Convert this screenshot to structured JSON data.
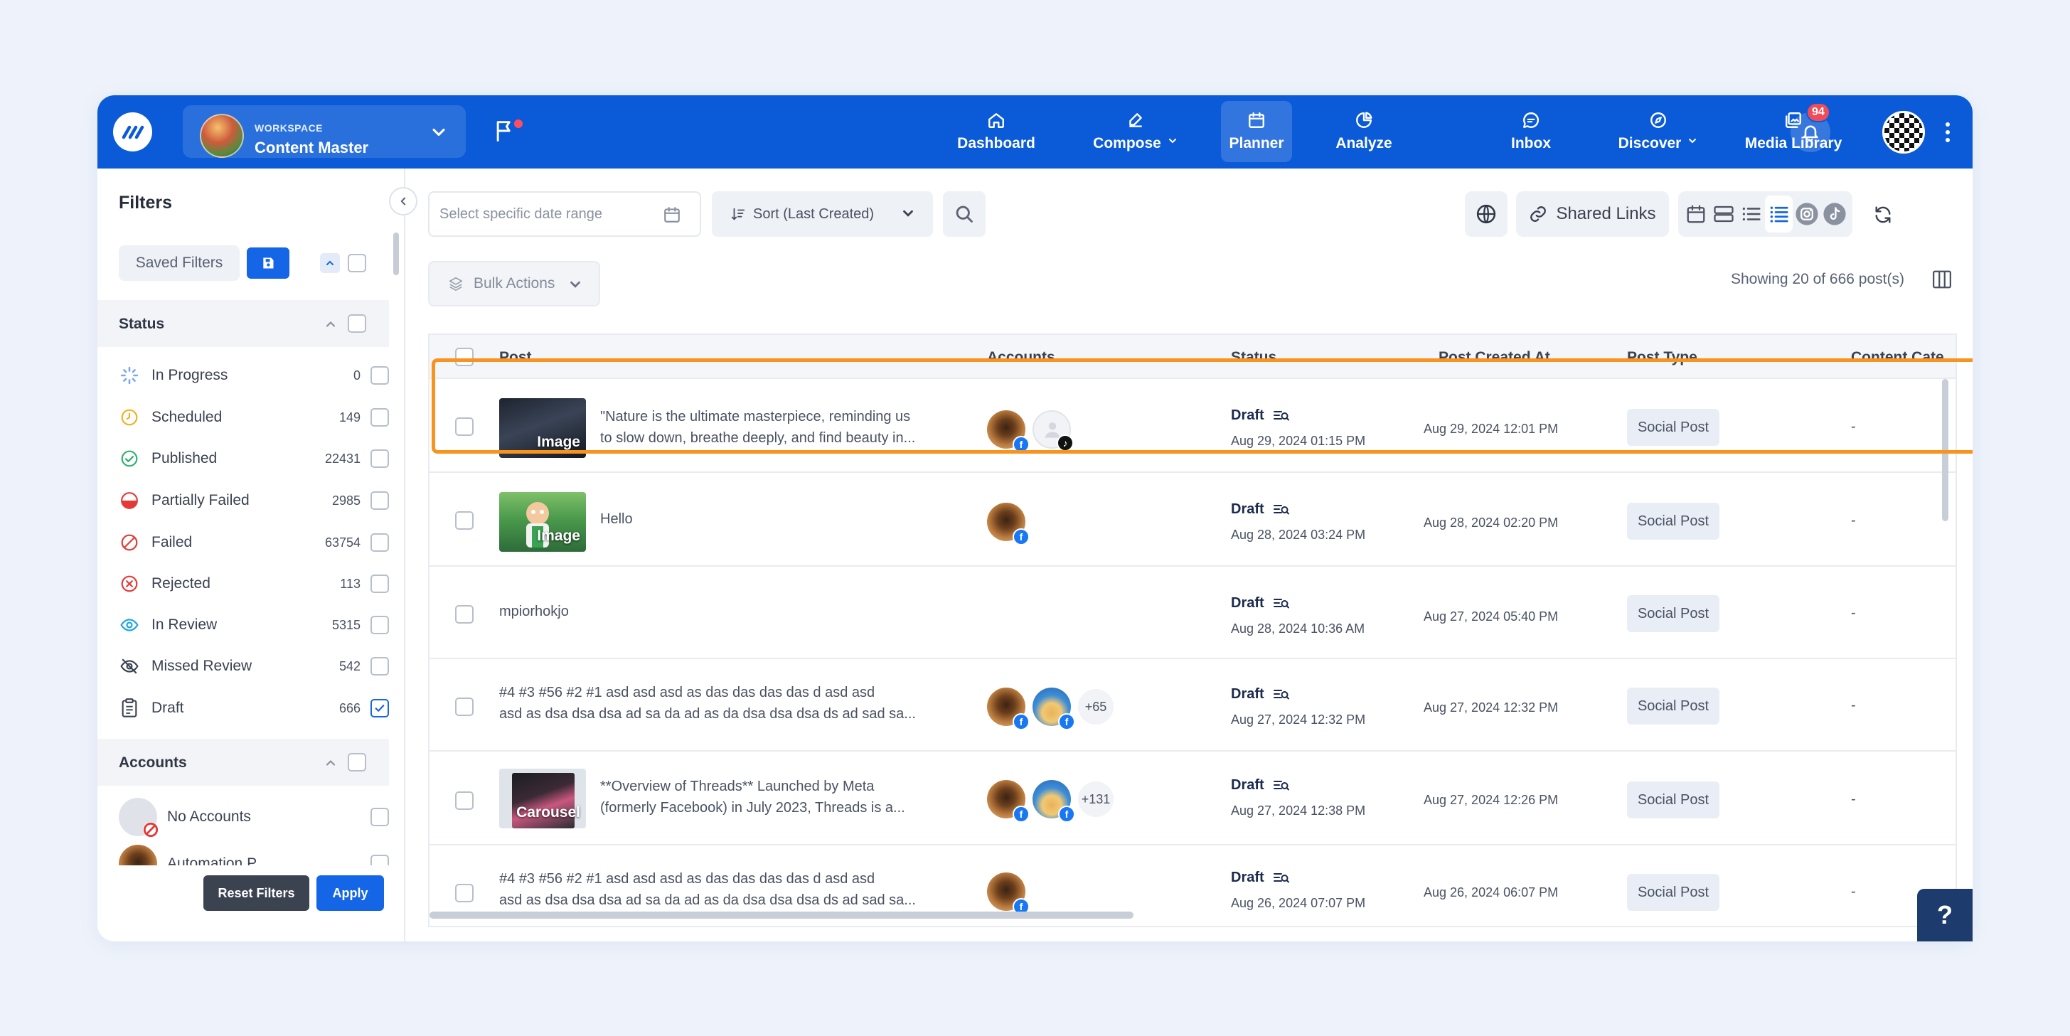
{
  "topbar": {
    "workspace_label": "WORKSPACE",
    "workspace_name": "Content Master",
    "nav": [
      {
        "label": "Dashboard",
        "icon": "home-icon"
      },
      {
        "label": "Compose",
        "icon": "pen-icon"
      },
      {
        "label": "Planner",
        "icon": "calendar-icon"
      },
      {
        "label": "Analyze",
        "icon": "pie-chart-icon"
      },
      {
        "label": "Inbox",
        "icon": "chat-icon"
      },
      {
        "label": "Discover",
        "icon": "compass-icon"
      },
      {
        "label": "Media Library",
        "icon": "images-icon"
      }
    ],
    "notification_count": "94"
  },
  "sidebar": {
    "title": "Filters",
    "saved_filters_label": "Saved Filters",
    "status_section": "Status",
    "statuses": [
      {
        "name": "In Progress",
        "count": "0",
        "color": "#7aa7f0"
      },
      {
        "name": "Scheduled",
        "count": "149",
        "color": "#f2b01e"
      },
      {
        "name": "Published",
        "count": "22431",
        "color": "#2db36b"
      },
      {
        "name": "Partially Failed",
        "count": "2985",
        "color": "#e53935"
      },
      {
        "name": "Failed",
        "count": "63754",
        "color": "#e53935"
      },
      {
        "name": "Rejected",
        "count": "113",
        "color": "#e53935"
      },
      {
        "name": "In Review",
        "count": "5315",
        "color": "#1aa3e0"
      },
      {
        "name": "Missed Review",
        "count": "542",
        "color": "#3a4150"
      },
      {
        "name": "Draft",
        "count": "666",
        "color": "#3a4150",
        "checked": true
      }
    ],
    "accounts_section": "Accounts",
    "accounts": [
      {
        "name": "No Accounts"
      },
      {
        "name": "Automation P..."
      }
    ],
    "reset_label": "Reset Filters",
    "apply_label": "Apply"
  },
  "toolbar": {
    "date_placeholder": "Select specific date range",
    "sort_label": "Sort (Last Created)",
    "shared_links_label": "Shared Links",
    "bulk_actions_label": "Bulk Actions",
    "showing_text": "Showing 20 of 666 post(s)"
  },
  "table": {
    "columns": [
      "Post",
      "Accounts",
      "Status",
      "Post Created At",
      "Post Type",
      "Content Cate"
    ],
    "rows": [
      {
        "thumb_tag": "Image",
        "text_line1": "\"Nature is the ultimate masterpiece, reminding us",
        "text_line2": "to slow down, breathe deeply, and find beauty in...",
        "status": "Draft",
        "status_date": "Aug 29, 2024 01:15 PM",
        "created": "Aug 29, 2024 12:01 PM",
        "type": "Social Post",
        "category": "-"
      },
      {
        "thumb_tag": "Image",
        "text_line1": "Hello",
        "text_line2": "",
        "status": "Draft",
        "status_date": "Aug 28, 2024 03:24 PM",
        "created": "Aug 28, 2024 02:20 PM",
        "type": "Social Post",
        "category": "-"
      },
      {
        "thumb_tag": "",
        "text_line1": "mpiorhokjo",
        "text_line2": "",
        "status": "Draft",
        "status_date": "Aug 28, 2024 10:36 AM",
        "created": "Aug 27, 2024 05:40 PM",
        "type": "Social Post",
        "category": "-"
      },
      {
        "thumb_tag": "",
        "text_line1": "#4 #3 #56 #2 #1 asd asd asd as das das das das d asd asd",
        "text_line2": "asd as dsa dsa dsa ad sa da ad as da dsa dsa dsa ds ad sad sa...",
        "more": "+65",
        "status": "Draft",
        "status_date": "Aug 27, 2024 12:32 PM",
        "created": "Aug 27, 2024 12:32 PM",
        "type": "Social Post",
        "category": "-"
      },
      {
        "thumb_tag": "Carousel",
        "text_line1": "**Overview of Threads** Launched by Meta",
        "text_line2": "(formerly Facebook) in July 2023, Threads is a...",
        "more": "+131",
        "status": "Draft",
        "status_date": "Aug 27, 2024 12:38 PM",
        "created": "Aug 27, 2024 12:26 PM",
        "type": "Social Post",
        "category": "-"
      },
      {
        "thumb_tag": "",
        "text_line1": "#4 #3 #56 #2 #1 asd asd asd as das das das das d asd asd",
        "text_line2": "asd as dsa dsa dsa ad sa da ad as da dsa dsa dsa ds ad sad sa...",
        "status": "Draft",
        "status_date": "Aug 26, 2024 07:07 PM",
        "created": "Aug 26, 2024 06:07 PM",
        "type": "Social Post",
        "category": "-"
      }
    ]
  },
  "help_label": "?",
  "colors": {
    "brand": "#0b5bd8",
    "highlight": "#f7931e",
    "facebook": "#1877f2"
  }
}
